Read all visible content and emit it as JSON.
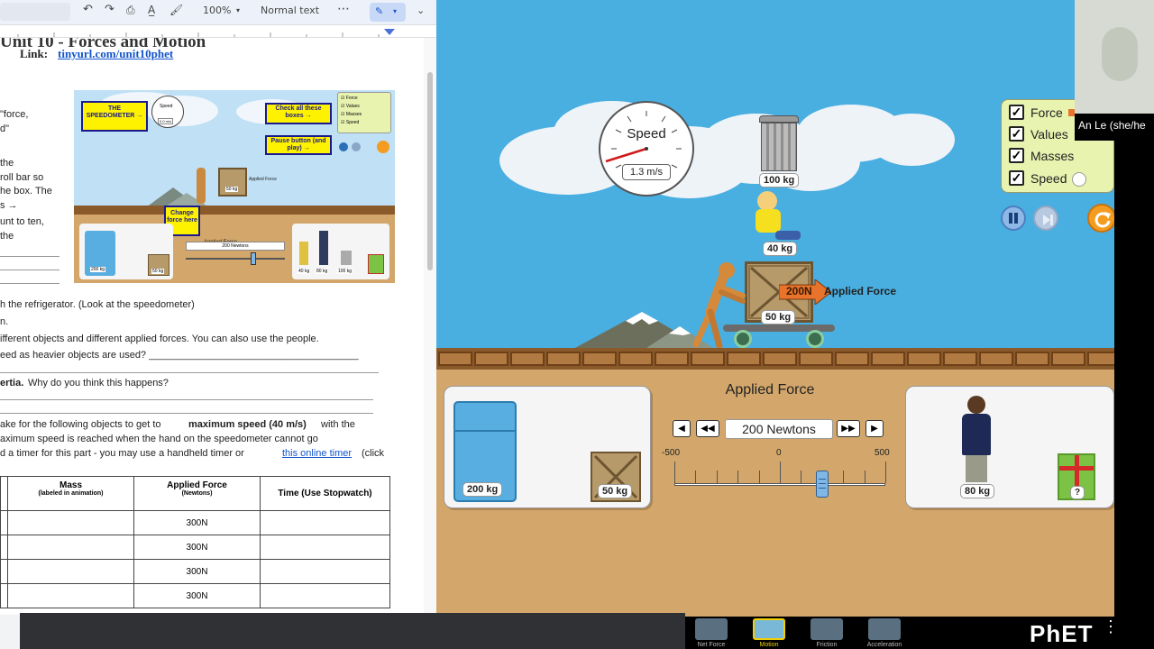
{
  "doc": {
    "toolbar": {
      "zoom": "100%",
      "style": "Normal text",
      "more": "⋯"
    },
    "heading": "Unit 10 - Forces and Motion",
    "link_label": "Link:",
    "link_text": "tinyurl.com/unit10phet",
    "left_fragments": [
      "\"force,",
      "d\"",
      "",
      "the",
      "roll bar so",
      "he box. The",
      "s →",
      "unt to ten,",
      "the"
    ],
    "lines": [
      "h the refrigerator. (Look at the speedometer)",
      "n.",
      "ifferent objects and different applied forces. You can also use the people.",
      "eed as heavier objects are used? ______________________________________",
      "ertia.",
      "Why do you think this happens?",
      "ake for the following objects to get to",
      "maximum speed (40 m/s)",
      "with the",
      "aximum speed is reached when the hand on the speedometer cannot go",
      "d a timer for this part - you may use a handheld timer or",
      "this online timer",
      "(click"
    ],
    "thumbnail": {
      "speedometer_label": "THE SPEEDOMETER →",
      "speed_word": "Speed",
      "speed_value": "0.0 m/s",
      "check_boxes": "Check all these boxes →",
      "pause_button": "Pause button (and play) →",
      "change_force": "Change force here",
      "applied_force": "Applied Force",
      "newtons": "200 Newtons",
      "checks": [
        "Force",
        "Values",
        "Masses",
        "Speed"
      ],
      "weights": {
        "crate": "50 kg",
        "fridge": "200 kg",
        "small_crate": "50 kg",
        "girl": "40 kg",
        "man": "80 kg",
        "trash": "100 kg"
      },
      "small_applied": "Applied Force"
    },
    "table": {
      "headers": [
        "",
        "Mass",
        "Applied Force",
        "Time (Use Stopwatch)"
      ],
      "subheaders": [
        "",
        "(labeled in animation)",
        "(Newtons)",
        ""
      ],
      "rows": [
        [
          "",
          "",
          "300N",
          ""
        ],
        [
          "",
          "",
          "300N",
          ""
        ],
        [
          "",
          "",
          "300N",
          ""
        ],
        [
          "",
          "",
          "300N",
          ""
        ]
      ]
    }
  },
  "sim": {
    "speedometer": {
      "label": "Speed",
      "value": "1.3 m/s"
    },
    "stack_labels": {
      "trash_can": "100 kg",
      "girl": "40 kg",
      "crate": "50 kg"
    },
    "force_arrow": "200N",
    "applied_force_label": "Applied Force",
    "checkboxes": [
      {
        "label": "Force",
        "checked": true
      },
      {
        "label": "Values",
        "checked": true
      },
      {
        "label": "Masses",
        "checked": true
      },
      {
        "label": "Speed",
        "checked": true
      }
    ],
    "control_panel": {
      "title": "Applied Force",
      "value": "200 Newtons",
      "slider_min": "-500",
      "slider_mid": "0",
      "slider_max": "500",
      "slider_value": 200
    },
    "left_panel": {
      "fridge": "200 kg",
      "crate": "50 kg"
    },
    "right_panel": {
      "man": "80 kg",
      "mystery": "?"
    }
  },
  "webcam": {
    "name": "An Le (she/he"
  },
  "screens": [
    {
      "label": "Net Force",
      "active": false
    },
    {
      "label": "Motion",
      "active": true
    },
    {
      "label": "Friction",
      "active": false
    },
    {
      "label": "Acceleration",
      "active": false
    }
  ],
  "phet_logo": "PhET",
  "colors": {
    "sky": "#49aee0",
    "ground": "#d3a76b",
    "brick": "#b07a42",
    "force_arrow": "#e8732a",
    "fridge": "#58aee0",
    "crate": "#b69a6a"
  }
}
